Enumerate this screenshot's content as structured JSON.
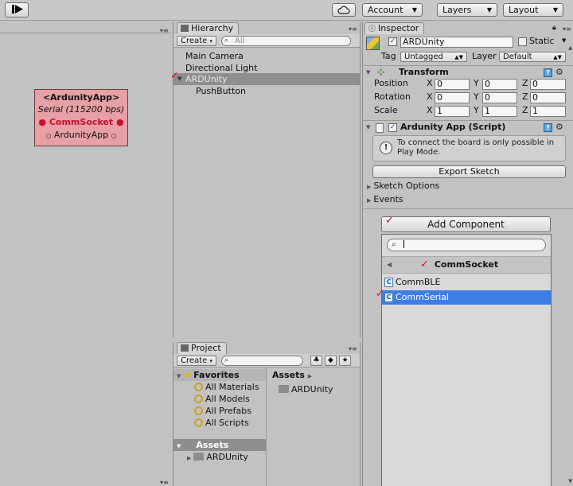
{
  "toolbar": {
    "step_icon": "step-forward-icon",
    "cloud_icon": "cloud-icon",
    "account_label": "Account",
    "layers_label": "Layers",
    "layout_label": "Layout"
  },
  "graph": {
    "node_title": "<ArdunityApp>",
    "node_subtitle": "Serial (115200 bps)",
    "node_comm": "CommSocket",
    "node_app": "ArdunityApp",
    "node_color": "#e7a0a6",
    "comm_color": "#c8102e"
  },
  "hierarchy": {
    "tab_label": "Hierarchy",
    "create_label": "Create",
    "search_placeholder": "All",
    "items": [
      {
        "label": "Main Camera"
      },
      {
        "label": "Directional Light"
      },
      {
        "label": "ARDUnity"
      },
      {
        "label": "PushButton"
      }
    ]
  },
  "project": {
    "tab_label": "Project",
    "create_label": "Create",
    "favorites_label": "Favorites",
    "favorites": [
      {
        "label": "All Materials"
      },
      {
        "label": "All Models"
      },
      {
        "label": "All Prefabs"
      },
      {
        "label": "All Scripts"
      }
    ],
    "assets_label": "Assets",
    "assets_child": "ARDUnity",
    "assets_header": "Assets",
    "assets_item": "ARDUnity"
  },
  "inspector": {
    "tab_label": "Inspector",
    "object_name": "ARDUnity",
    "static_label": "Static",
    "tag_label": "Tag",
    "tag_value": "Untagged",
    "layer_label": "Layer",
    "layer_value": "Default",
    "transform_label": "Transform",
    "position_label": "Position",
    "rotation_label": "Rotation",
    "scale_label": "Scale",
    "axis_x": "X",
    "axis_y": "Y",
    "axis_z": "Z",
    "position": {
      "x": "0",
      "y": "0",
      "z": "0"
    },
    "rotation": {
      "x": "0",
      "y": "0",
      "z": "0"
    },
    "scale": {
      "x": "1",
      "y": "1",
      "z": "1"
    },
    "script_label": "Ardunity App (Script)",
    "info_text": "To connect the board is only possible in Play Mode.",
    "export_label": "Export Sketch",
    "sketch_options_label": "Sketch Options",
    "events_label": "Events",
    "add_component_label": "Add Component"
  },
  "popup": {
    "search_value": "",
    "header_label": "CommSocket",
    "items": [
      {
        "label": "CommBLE"
      },
      {
        "label": "CommSerial"
      }
    ],
    "selected_color": "#3d7ee6"
  },
  "annotations": {
    "check_color": "#d4111a"
  }
}
